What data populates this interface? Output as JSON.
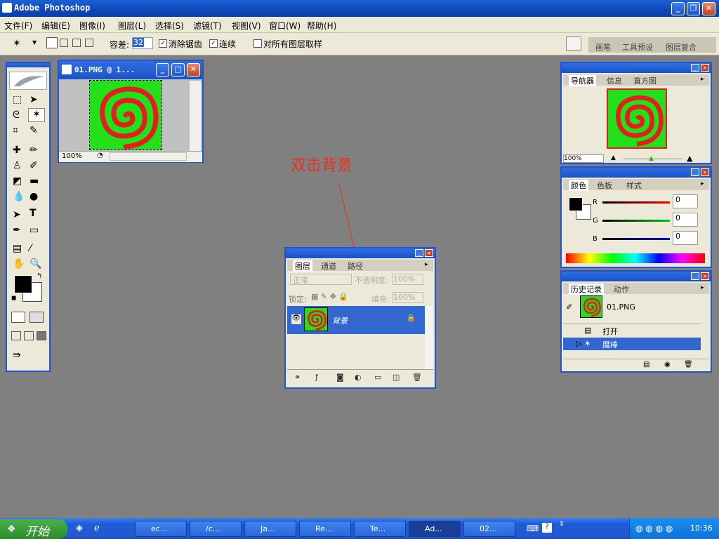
{
  "app": {
    "title": "Adobe Photoshop"
  },
  "menu": [
    "文件(F)",
    "编辑(E)",
    "图像(I)",
    "图层(L)",
    "选择(S)",
    "滤镜(T)",
    "视图(V)",
    "窗口(W)",
    "帮助(H)"
  ],
  "options": {
    "tolerance_label": "容差:",
    "tolerance_value": "32",
    "antialias_label": "消除锯齿",
    "contiguous_label": "连续",
    "all_layers_label": "对所有图层取样",
    "palette_tabs": [
      "画笔",
      "工具预设",
      "图层复合"
    ]
  },
  "document": {
    "title": "01.PNG @ 1...",
    "zoom": "100%"
  },
  "annotation": {
    "text": "双击背景",
    "color": "#e8321e"
  },
  "navigator": {
    "tabs": [
      "导航器",
      "信息",
      "直方图"
    ],
    "zoom": "100%"
  },
  "color_panel": {
    "tabs": [
      "颜色",
      "色板",
      "样式"
    ],
    "channels": [
      {
        "label": "R",
        "value": "0"
      },
      {
        "label": "G",
        "value": "0"
      },
      {
        "label": "B",
        "value": "0"
      }
    ]
  },
  "history": {
    "tabs": [
      "历史记录",
      "动作"
    ],
    "snapshot": "01.PNG",
    "items": [
      "打开",
      "魔棒"
    ]
  },
  "layers": {
    "tabs": [
      "图层",
      "通道",
      "路径"
    ],
    "blend_mode": "正常",
    "opacity_label": "不透明度:",
    "opacity_value": "100%",
    "lock_label": "锁定:",
    "fill_label": "填充:",
    "fill_value": "100%",
    "layer_name": "背景"
  },
  "taskbar": {
    "start_label": "开始",
    "items": [
      "ec...",
      "/c...",
      "Ja...",
      "Re...",
      "Te...",
      "Ad...",
      "02..."
    ],
    "time": "10:36"
  },
  "colors": {
    "xp_blue": "#1e55d2",
    "panel_bg": "#ece9d8",
    "canvas_green": "#22e01a",
    "spiral_red": "#e41e1e"
  }
}
